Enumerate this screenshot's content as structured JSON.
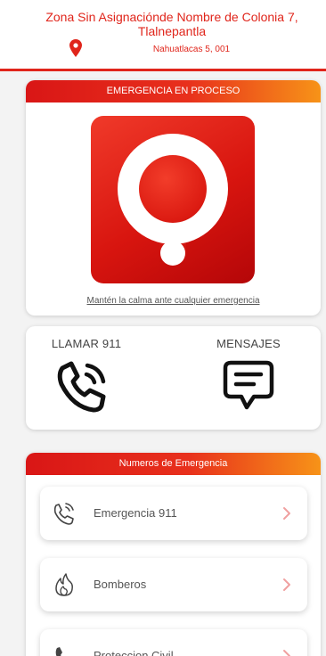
{
  "header": {
    "location_title": "Zona Sin Asignaciónde Nombre de Colonia 7, Tlalnepantla",
    "address": "Nahuatlacas 5, 001",
    "pin_icon": "map-pin-icon"
  },
  "emergency": {
    "banner": "EMERGENCIA EN PROCESO",
    "logo_icon": "alert-logo-icon",
    "calm_message": "Mantén la calma ante cualquier emergencia"
  },
  "actions": {
    "call_label": "LLAMAR 911",
    "call_icon": "phone-ringing-icon",
    "messages_label": "MENSAJES",
    "messages_icon": "chat-bubble-icon"
  },
  "numbers": {
    "banner": "Numeros de Emergencia",
    "items": [
      {
        "label": "Emergencia 911",
        "icon": "phone-ringing-icon"
      },
      {
        "label": "Bomberos",
        "icon": "fire-icon"
      },
      {
        "label": "Proteccion Civil",
        "icon": "phone-icon"
      }
    ]
  },
  "colors": {
    "primary_red": "#e0251b",
    "gradient_orange": "#f79318",
    "background": "#f3f3f3"
  }
}
